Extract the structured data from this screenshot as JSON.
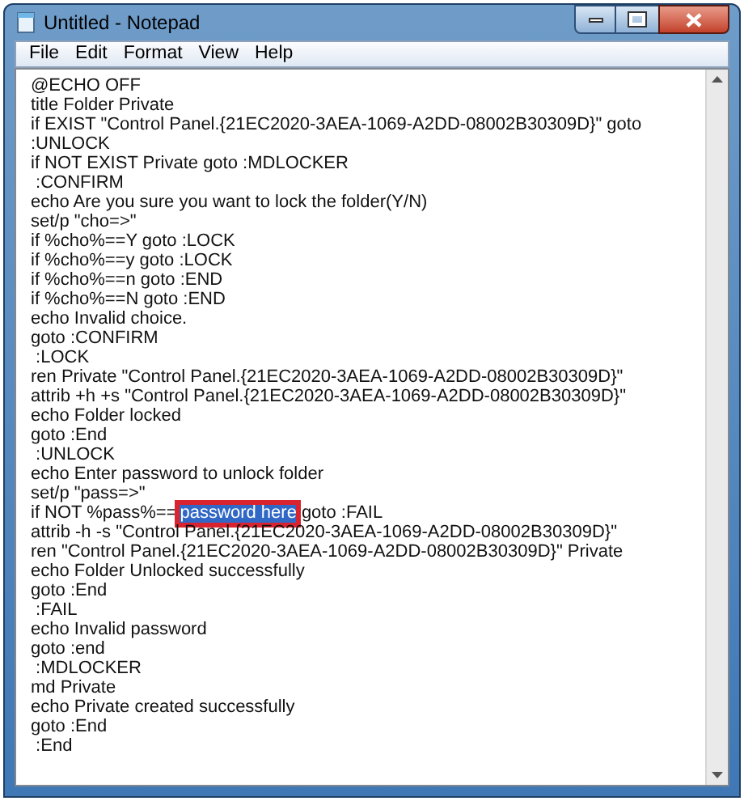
{
  "window": {
    "title": "Untitled - Notepad"
  },
  "menu": [
    "File",
    "Edit",
    "Format",
    "View",
    "Help"
  ],
  "lines": [
    {
      "kind": "plain",
      "text": "@ECHO OFF"
    },
    {
      "kind": "plain",
      "text": "title Folder Private"
    },
    {
      "kind": "plain",
      "text": "if EXIST \"Control Panel.{21EC2020-3AEA-1069-A2DD-08002B30309D}\" goto"
    },
    {
      "kind": "plain",
      "text": ":UNLOCK"
    },
    {
      "kind": "plain",
      "text": "if NOT EXIST Private goto :MDLOCKER"
    },
    {
      "kind": "plain",
      "text": " :CONFIRM"
    },
    {
      "kind": "plain",
      "text": "echo Are you sure you want to lock the folder(Y/N)"
    },
    {
      "kind": "plain",
      "text": "set/p \"cho=>\""
    },
    {
      "kind": "plain",
      "text": "if %cho%==Y goto :LOCK"
    },
    {
      "kind": "plain",
      "text": "if %cho%==y goto :LOCK"
    },
    {
      "kind": "plain",
      "text": "if %cho%==n goto :END"
    },
    {
      "kind": "plain",
      "text": "if %cho%==N goto :END"
    },
    {
      "kind": "plain",
      "text": "echo Invalid choice."
    },
    {
      "kind": "plain",
      "text": "goto :CONFIRM"
    },
    {
      "kind": "plain",
      "text": " :LOCK"
    },
    {
      "kind": "plain",
      "text": "ren Private \"Control Panel.{21EC2020-3AEA-1069-A2DD-08002B30309D}\""
    },
    {
      "kind": "plain",
      "text": "attrib +h +s \"Control Panel.{21EC2020-3AEA-1069-A2DD-08002B30309D}\""
    },
    {
      "kind": "plain",
      "text": "echo Folder locked"
    },
    {
      "kind": "plain",
      "text": "goto :End"
    },
    {
      "kind": "plain",
      "text": " :UNLOCK"
    },
    {
      "kind": "plain",
      "text": "echo Enter password to unlock folder"
    },
    {
      "kind": "plain",
      "text": "set/p \"pass=>\""
    },
    {
      "kind": "selection",
      "before": "if NOT %pass%==",
      "selected": "password here",
      "after": "goto :FAIL",
      "boxed": true
    },
    {
      "kind": "plain",
      "text": "attrib -h -s \"Control Panel.{21EC2020-3AEA-1069-A2DD-08002B30309D}\""
    },
    {
      "kind": "plain",
      "text": "ren \"Control Panel.{21EC2020-3AEA-1069-A2DD-08002B30309D}\" Private"
    },
    {
      "kind": "plain",
      "text": "echo Folder Unlocked successfully"
    },
    {
      "kind": "plain",
      "text": "goto :End"
    },
    {
      "kind": "plain",
      "text": " :FAIL"
    },
    {
      "kind": "plain",
      "text": "echo Invalid password"
    },
    {
      "kind": "plain",
      "text": "goto :end"
    },
    {
      "kind": "plain",
      "text": " :MDLOCKER"
    },
    {
      "kind": "plain",
      "text": "md Private"
    },
    {
      "kind": "plain",
      "text": "echo Private created successfully"
    },
    {
      "kind": "plain",
      "text": "goto :End"
    },
    {
      "kind": "plain",
      "text": " :End"
    }
  ]
}
